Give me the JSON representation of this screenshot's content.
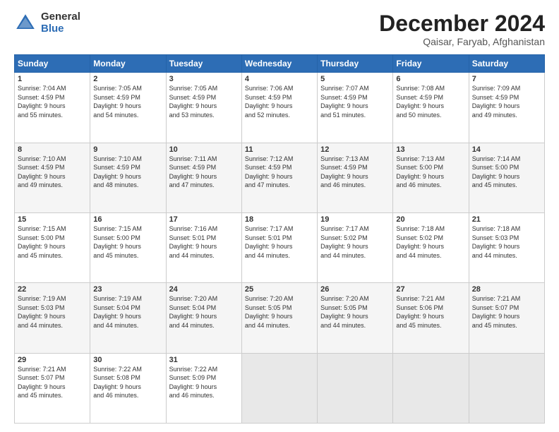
{
  "header": {
    "logo_general": "General",
    "logo_blue": "Blue",
    "title": "December 2024",
    "location": "Qaisar, Faryab, Afghanistan"
  },
  "weekdays": [
    "Sunday",
    "Monday",
    "Tuesday",
    "Wednesday",
    "Thursday",
    "Friday",
    "Saturday"
  ],
  "weeks": [
    [
      {
        "day": "1",
        "info": "Sunrise: 7:04 AM\nSunset: 4:59 PM\nDaylight: 9 hours\nand 55 minutes."
      },
      {
        "day": "2",
        "info": "Sunrise: 7:05 AM\nSunset: 4:59 PM\nDaylight: 9 hours\nand 54 minutes."
      },
      {
        "day": "3",
        "info": "Sunrise: 7:05 AM\nSunset: 4:59 PM\nDaylight: 9 hours\nand 53 minutes."
      },
      {
        "day": "4",
        "info": "Sunrise: 7:06 AM\nSunset: 4:59 PM\nDaylight: 9 hours\nand 52 minutes."
      },
      {
        "day": "5",
        "info": "Sunrise: 7:07 AM\nSunset: 4:59 PM\nDaylight: 9 hours\nand 51 minutes."
      },
      {
        "day": "6",
        "info": "Sunrise: 7:08 AM\nSunset: 4:59 PM\nDaylight: 9 hours\nand 50 minutes."
      },
      {
        "day": "7",
        "info": "Sunrise: 7:09 AM\nSunset: 4:59 PM\nDaylight: 9 hours\nand 49 minutes."
      }
    ],
    [
      {
        "day": "8",
        "info": "Sunrise: 7:10 AM\nSunset: 4:59 PM\nDaylight: 9 hours\nand 49 minutes."
      },
      {
        "day": "9",
        "info": "Sunrise: 7:10 AM\nSunset: 4:59 PM\nDaylight: 9 hours\nand 48 minutes."
      },
      {
        "day": "10",
        "info": "Sunrise: 7:11 AM\nSunset: 4:59 PM\nDaylight: 9 hours\nand 47 minutes."
      },
      {
        "day": "11",
        "info": "Sunrise: 7:12 AM\nSunset: 4:59 PM\nDaylight: 9 hours\nand 47 minutes."
      },
      {
        "day": "12",
        "info": "Sunrise: 7:13 AM\nSunset: 4:59 PM\nDaylight: 9 hours\nand 46 minutes."
      },
      {
        "day": "13",
        "info": "Sunrise: 7:13 AM\nSunset: 5:00 PM\nDaylight: 9 hours\nand 46 minutes."
      },
      {
        "day": "14",
        "info": "Sunrise: 7:14 AM\nSunset: 5:00 PM\nDaylight: 9 hours\nand 45 minutes."
      }
    ],
    [
      {
        "day": "15",
        "info": "Sunrise: 7:15 AM\nSunset: 5:00 PM\nDaylight: 9 hours\nand 45 minutes."
      },
      {
        "day": "16",
        "info": "Sunrise: 7:15 AM\nSunset: 5:00 PM\nDaylight: 9 hours\nand 45 minutes."
      },
      {
        "day": "17",
        "info": "Sunrise: 7:16 AM\nSunset: 5:01 PM\nDaylight: 9 hours\nand 44 minutes."
      },
      {
        "day": "18",
        "info": "Sunrise: 7:17 AM\nSunset: 5:01 PM\nDaylight: 9 hours\nand 44 minutes."
      },
      {
        "day": "19",
        "info": "Sunrise: 7:17 AM\nSunset: 5:02 PM\nDaylight: 9 hours\nand 44 minutes."
      },
      {
        "day": "20",
        "info": "Sunrise: 7:18 AM\nSunset: 5:02 PM\nDaylight: 9 hours\nand 44 minutes."
      },
      {
        "day": "21",
        "info": "Sunrise: 7:18 AM\nSunset: 5:03 PM\nDaylight: 9 hours\nand 44 minutes."
      }
    ],
    [
      {
        "day": "22",
        "info": "Sunrise: 7:19 AM\nSunset: 5:03 PM\nDaylight: 9 hours\nand 44 minutes."
      },
      {
        "day": "23",
        "info": "Sunrise: 7:19 AM\nSunset: 5:04 PM\nDaylight: 9 hours\nand 44 minutes."
      },
      {
        "day": "24",
        "info": "Sunrise: 7:20 AM\nSunset: 5:04 PM\nDaylight: 9 hours\nand 44 minutes."
      },
      {
        "day": "25",
        "info": "Sunrise: 7:20 AM\nSunset: 5:05 PM\nDaylight: 9 hours\nand 44 minutes."
      },
      {
        "day": "26",
        "info": "Sunrise: 7:20 AM\nSunset: 5:05 PM\nDaylight: 9 hours\nand 44 minutes."
      },
      {
        "day": "27",
        "info": "Sunrise: 7:21 AM\nSunset: 5:06 PM\nDaylight: 9 hours\nand 45 minutes."
      },
      {
        "day": "28",
        "info": "Sunrise: 7:21 AM\nSunset: 5:07 PM\nDaylight: 9 hours\nand 45 minutes."
      }
    ],
    [
      {
        "day": "29",
        "info": "Sunrise: 7:21 AM\nSunset: 5:07 PM\nDaylight: 9 hours\nand 45 minutes."
      },
      {
        "day": "30",
        "info": "Sunrise: 7:22 AM\nSunset: 5:08 PM\nDaylight: 9 hours\nand 46 minutes."
      },
      {
        "day": "31",
        "info": "Sunrise: 7:22 AM\nSunset: 5:09 PM\nDaylight: 9 hours\nand 46 minutes."
      },
      {
        "day": "",
        "info": ""
      },
      {
        "day": "",
        "info": ""
      },
      {
        "day": "",
        "info": ""
      },
      {
        "day": "",
        "info": ""
      }
    ]
  ]
}
